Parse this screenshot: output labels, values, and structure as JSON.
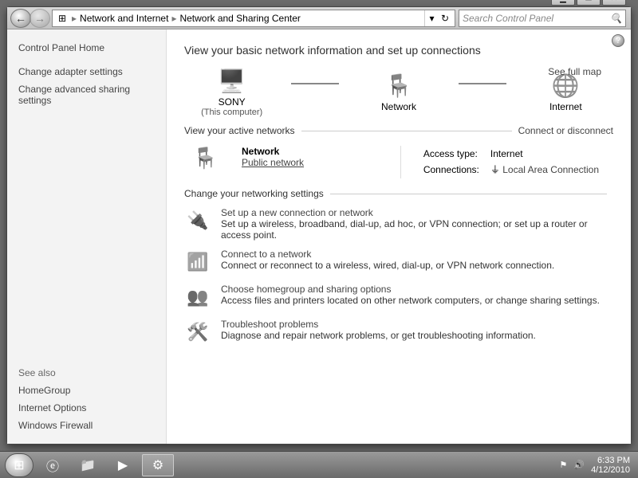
{
  "window_controls": {
    "min": "▁",
    "max": "▭",
    "close": "✕"
  },
  "nav": {
    "back": "←",
    "forward": "→"
  },
  "address": {
    "icon": "⊞",
    "crumbs": [
      "Network and Internet",
      "Network and Sharing Center"
    ],
    "refresh": "↻"
  },
  "search": {
    "placeholder": "Search Control Panel",
    "icon": "🔍"
  },
  "help_icon": "?",
  "sidebar": {
    "home": "Control Panel Home",
    "links": [
      "Change adapter settings",
      "Change advanced sharing settings"
    ],
    "see_also_label": "See also",
    "see_also": [
      "HomeGroup",
      "Internet Options",
      "Windows Firewall"
    ]
  },
  "heading": "View your basic network information and set up connections",
  "map": {
    "full_map": "See full map",
    "items": [
      {
        "label": "SONY",
        "sub": "(This computer)"
      },
      {
        "label": "Network",
        "sub": ""
      },
      {
        "label": "Internet",
        "sub": ""
      }
    ]
  },
  "active": {
    "heading": "View your active networks",
    "rightlink": "Connect or disconnect",
    "name": "Network",
    "type": "Public network",
    "access_label": "Access type:",
    "access_value": "Internet",
    "conn_label": "Connections:",
    "conn_value": "Local Area Connection"
  },
  "settings": {
    "heading": "Change your networking settings",
    "items": [
      {
        "title": "Set up a new connection or network",
        "desc": "Set up a wireless, broadband, dial-up, ad hoc, or VPN connection; or set up a router or access point."
      },
      {
        "title": "Connect to a network",
        "desc": "Connect or reconnect to a wireless, wired, dial-up, or VPN network connection."
      },
      {
        "title": "Choose homegroup and sharing options",
        "desc": "Access files and printers located on other network computers, or change sharing settings."
      },
      {
        "title": "Troubleshoot problems",
        "desc": "Diagnose and repair network problems, or get troubleshooting information."
      }
    ]
  },
  "taskbar": {
    "tray": {
      "volume": "🔊",
      "flag": "⚑",
      "time": "6:33 PM",
      "date": "4/12/2010"
    }
  }
}
